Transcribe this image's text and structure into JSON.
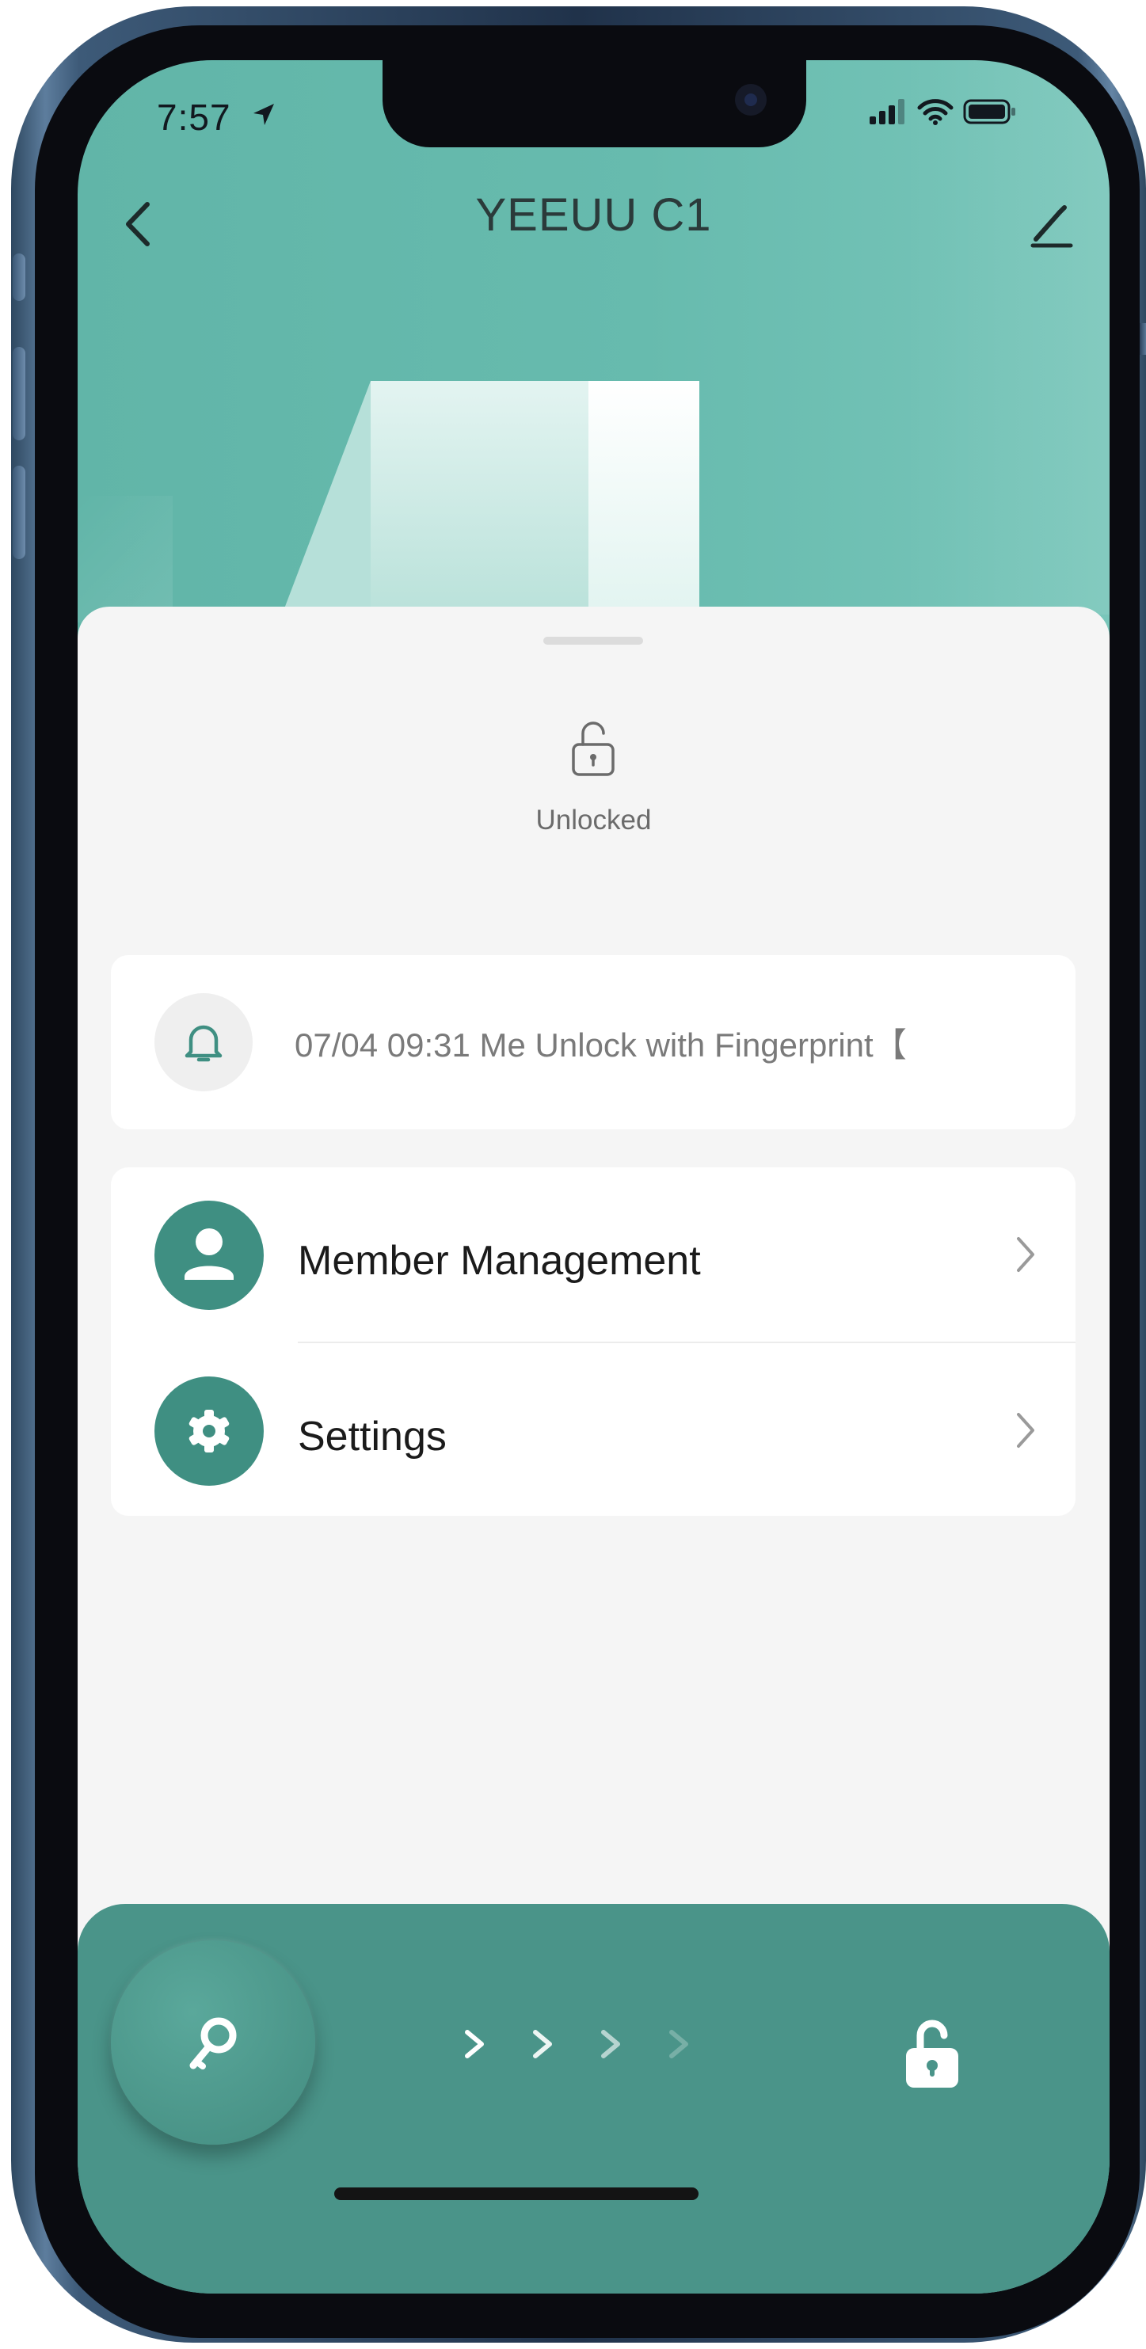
{
  "status_bar": {
    "time": "7:57"
  },
  "nav": {
    "title": "YEEUU C1",
    "back_icon": "chevron-left-icon",
    "edit_icon": "pencil-icon"
  },
  "lock_status": {
    "icon": "open-padlock-icon",
    "label": "Unlocked"
  },
  "latest_record": {
    "icon": "bell-icon",
    "text": "07/04 09:31 Me  Unlock with Fingerprint【"
  },
  "menu": [
    {
      "label": "Member Management",
      "icon": "person-icon"
    },
    {
      "label": "Settings",
      "icon": "gear-icon"
    }
  ],
  "unlock_slider": {
    "handle_icon": "key-icon",
    "target_icon": "unlocked-padlock-icon"
  },
  "colors": {
    "header_teal": "#67bbae",
    "accent_teal": "#3f8f82",
    "bottom_bar": "#4a9489",
    "sheet_bg": "#f5f5f5",
    "card_bg": "#ffffff"
  }
}
